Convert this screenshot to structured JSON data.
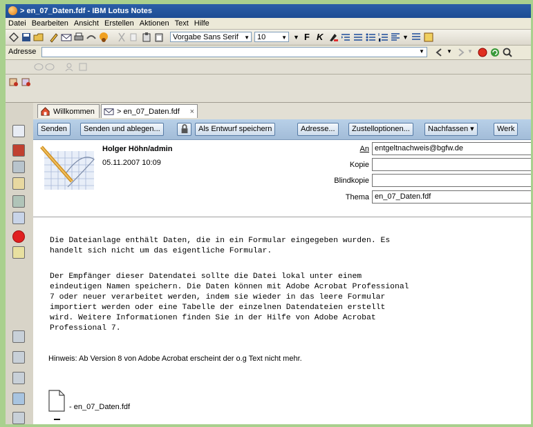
{
  "window": {
    "title": "> en_07_Daten.fdf - IBM Lotus Notes"
  },
  "menu": [
    "Datei",
    "Bearbeiten",
    "Ansicht",
    "Erstellen",
    "Aktionen",
    "Text",
    "Hilfe"
  ],
  "toolbar": {
    "font_family": "Vorgabe Sans Serif",
    "font_size": "10",
    "bold_label": "F",
    "italic_label": "K"
  },
  "address_bar": {
    "label": "Adresse",
    "value": ""
  },
  "tabs": [
    {
      "label": "Willkommen",
      "icon": "home-icon"
    },
    {
      "label": "> en_07_Daten.fdf",
      "icon": "mail-icon",
      "close": "×"
    }
  ],
  "actions": [
    "Senden",
    "Senden und ablegen...",
    "Als Entwurf speichern",
    "Adresse...",
    "Zustelloptionen...",
    "Nachfassen ▾",
    "Werk"
  ],
  "message": {
    "sender": "Holger Höhn/admin",
    "date": "05.11.2007 10:09",
    "fields": [
      {
        "label": "An",
        "value": "entgeltnachweis@bgfw.de"
      },
      {
        "label": "Kopie",
        "value": ""
      },
      {
        "label": "Blindkopie",
        "value": ""
      },
      {
        "label": "Thema",
        "value": "en_07_Daten.fdf"
      }
    ],
    "body_paragraph_1": [
      "Die Dateianlage enthält Daten, die in ein Formular eingegeben wurden. Es",
      "handelt sich nicht um das eigentliche Formular."
    ],
    "body_paragraph_2": [
      "Der Empfänger dieser Datendatei sollte die Datei lokal unter einem",
      "eindeutigen Namen speichern. Die Daten können mit Adobe Acrobat Professional",
      "7 oder neuer verarbeitet werden, indem sie wieder in das leere Formular",
      "importiert werden oder eine Tabelle der einzelnen Datendateien erstellt",
      "wird. Weitere Informationen finden Sie in der Hilfe von Adobe Acrobat",
      "Professional 7."
    ],
    "note": "Hinweis: Ab Version 8 von Adobe Acrobat erscheint der o.g Text nicht mehr.",
    "attachment_name": "- en_07_Daten.fdf"
  }
}
